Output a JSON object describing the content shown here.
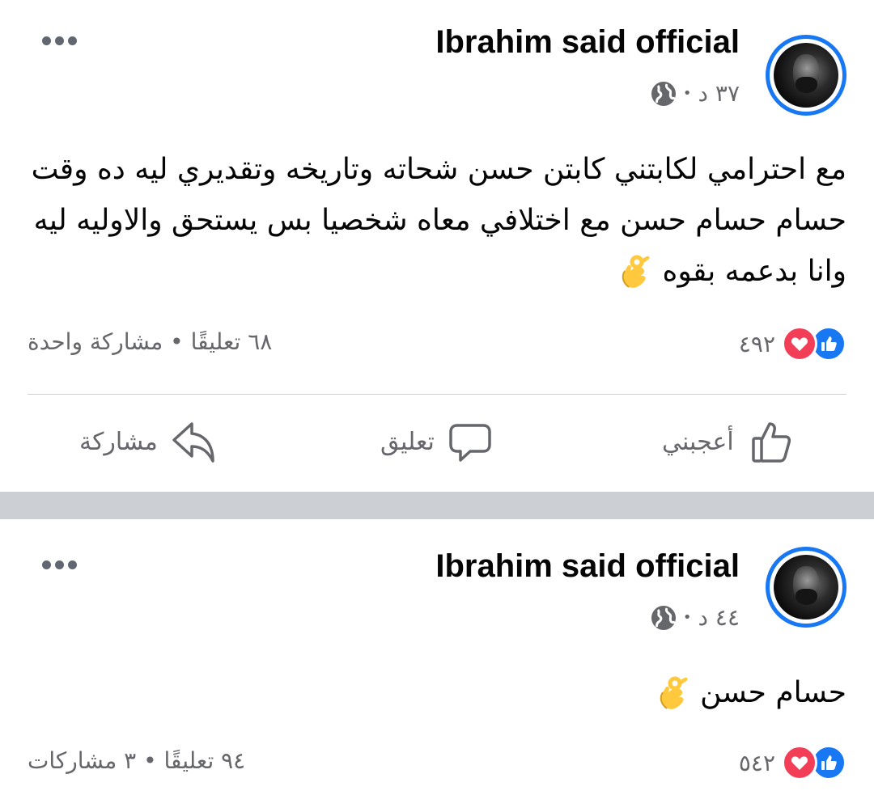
{
  "posts": [
    {
      "author": "Ibrahim said official",
      "time": "٣٧ د",
      "dot": "•",
      "text": "مع احترامي لكابتني كابتن حسن شحاته وتاريخه وتقديري ليه ده وقت حسام حسام حسن مع اختلافي معاه شخصيا بس يستحق والاوليه ليه وانا بدعمه بقوه",
      "reactions_count": "٤٩٢",
      "stats": "٦٨ تعليقًا • مشاركة واحدة"
    },
    {
      "author": "Ibrahim said official",
      "time": "٤٤ د",
      "dot": "•",
      "text": "حسام حسن",
      "reactions_count": "٥٤٢",
      "stats": "٩٤ تعليقًا • ٣ مشاركات"
    }
  ],
  "actions": {
    "like": "أعجبني",
    "comment": "تعليق",
    "share": "مشاركة"
  },
  "icons": {
    "more": "more-horizontal-icon",
    "globe": "globe-icon",
    "emoji": "ok-hand-emoji",
    "like_reaction": "like-reaction-icon",
    "love_reaction": "love-reaction-icon"
  },
  "colors": {
    "accent": "#1877f2",
    "love": "#f33e58",
    "secondary_text": "#65676b",
    "separator": "#ccd0d5"
  }
}
